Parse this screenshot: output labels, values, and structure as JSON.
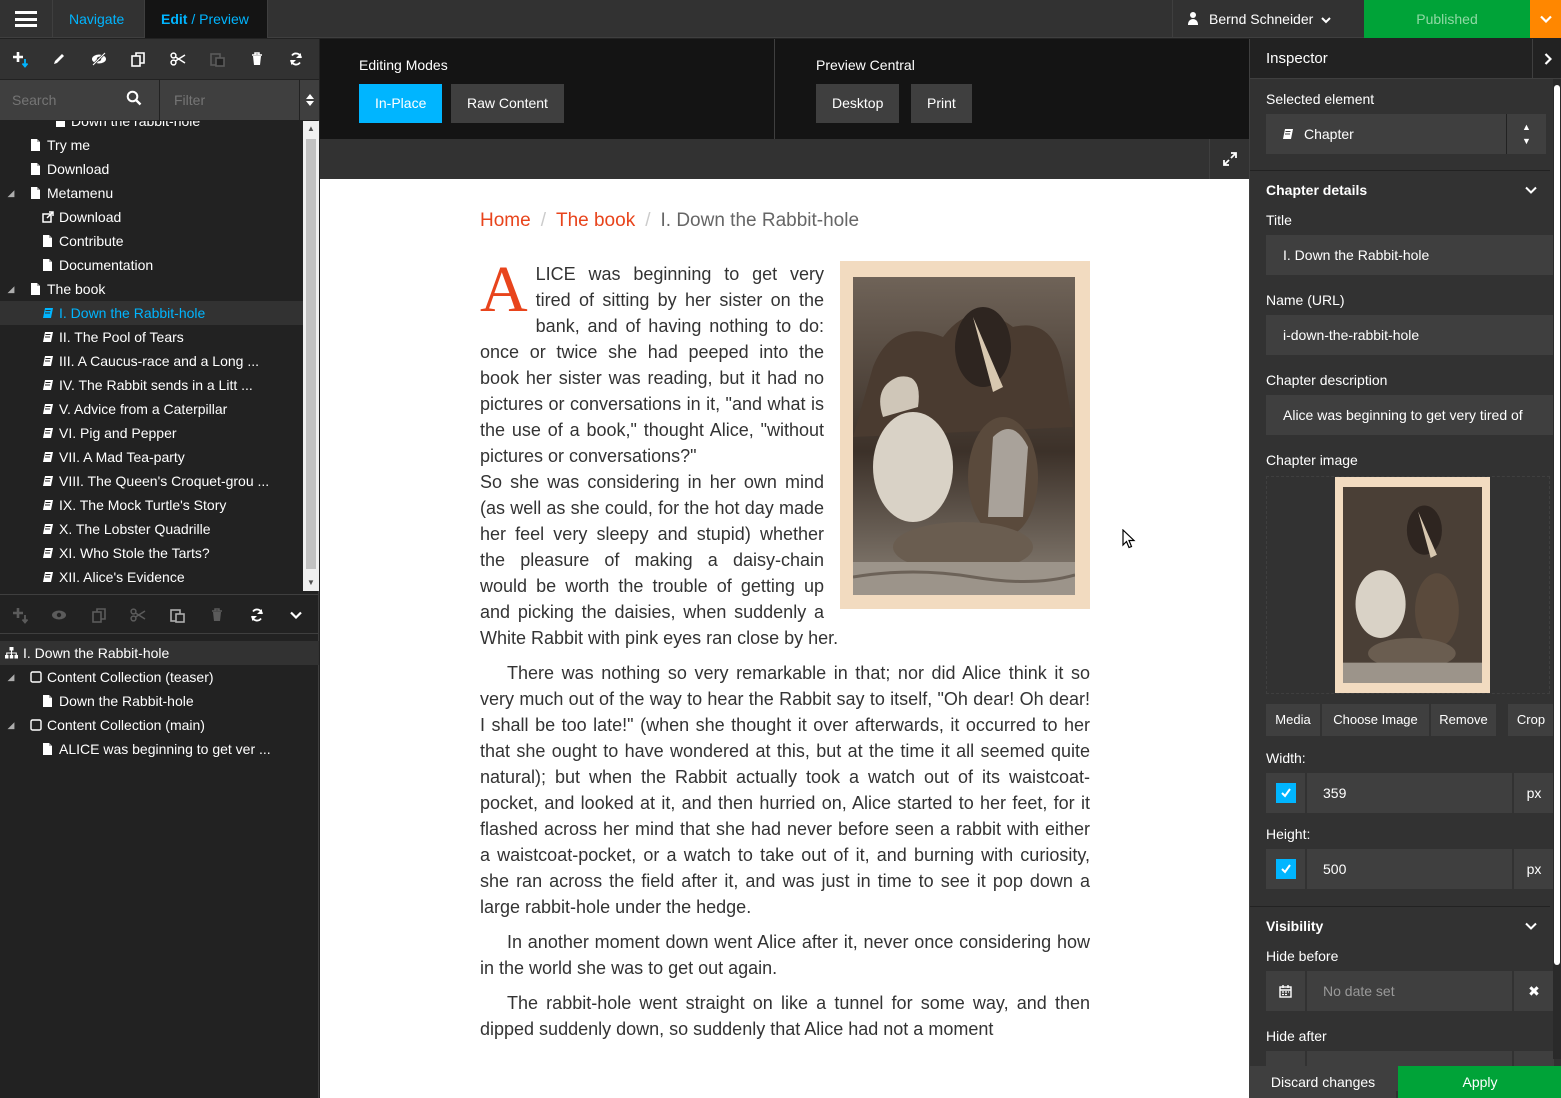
{
  "topbar": {
    "navigate_label": "Navigate",
    "edit_label": "Edit",
    "edit_sep": " / ",
    "preview_label": "Preview",
    "user_name": "Bernd Schneider",
    "published_label": "Published"
  },
  "sidebar": {
    "search_placeholder": "Search",
    "filter_placeholder": "Filter",
    "tree": [
      {
        "label": "Down the rabbit-hole",
        "icon": "document-icon"
      },
      {
        "label": "Try me",
        "icon": "document-icon"
      },
      {
        "label": "Download",
        "icon": "document-icon"
      },
      {
        "label": "Metamenu",
        "icon": "document-icon"
      },
      {
        "label": "Download",
        "icon": "external-link-icon"
      },
      {
        "label": "Contribute",
        "icon": "document-icon"
      },
      {
        "label": "Documentation",
        "icon": "document-icon"
      },
      {
        "label": "The book",
        "icon": "document-icon"
      },
      {
        "label": "I. Down the Rabbit-hole",
        "icon": "book-icon"
      },
      {
        "label": "II. The Pool of Tears",
        "icon": "book-icon"
      },
      {
        "label": "III. A Caucus-race and a Long ...",
        "icon": "book-icon"
      },
      {
        "label": "IV. The Rabbit sends in a Litt ...",
        "icon": "book-icon"
      },
      {
        "label": "V. Advice from a Caterpillar",
        "icon": "book-icon"
      },
      {
        "label": "VI. Pig and Pepper",
        "icon": "book-icon"
      },
      {
        "label": "VII. A Mad Tea-party",
        "icon": "book-icon"
      },
      {
        "label": "VIII. The Queen's Croquet-grou ...",
        "icon": "book-icon"
      },
      {
        "label": "IX. The Mock Turtle's Story",
        "icon": "book-icon"
      },
      {
        "label": "X. The Lobster Quadrille",
        "icon": "book-icon"
      },
      {
        "label": "XI. Who Stole the Tarts?",
        "icon": "book-icon"
      },
      {
        "label": "XII. Alice's Evidence",
        "icon": "book-icon"
      }
    ],
    "structure": [
      {
        "label": "I. Down the Rabbit-hole",
        "icon": "sitemap-icon"
      },
      {
        "label": "Content Collection (teaser)",
        "icon": "collection-icon"
      },
      {
        "label": "Down the Rabbit-hole",
        "icon": "document-icon"
      },
      {
        "label": "Content Collection (main)",
        "icon": "collection-icon"
      },
      {
        "label": "ALICE was beginning to get ver ...",
        "icon": "document-icon"
      }
    ]
  },
  "modes": {
    "editing_title": "Editing Modes",
    "in_place_label": "In-Place",
    "raw_content_label": "Raw Content",
    "preview_title": "Preview Central",
    "desktop_label": "Desktop",
    "print_label": "Print"
  },
  "page": {
    "breadcrumb": [
      "Home",
      "The book",
      "I. Down the Rabbit-hole"
    ],
    "dropcap": "A",
    "p1a": "LICE was beginning to get very tired of sitting by her sister on the bank, and of having nothing to do: once or twice she had peeped into the book her sister was reading, but it had no pictures or conversations in it, \"and what is the use of a book,\" thought Alice, \"without pictures or conversations?\"",
    "p1b": "So she was considering in her own mind (as well as she could, for the hot day made her feel very sleepy and stupid) whether the pleasure of making a daisy-chain would be worth the trouble of getting up and picking the daisies, when suddenly a White Rabbit with pink eyes ran close by her.",
    "p2": "There was nothing so very remarkable in that; nor did Alice think it so very much out of the way to hear the Rabbit say to itself, \"Oh dear! Oh dear! I shall be too late!\" (when she thought it over afterwards, it occurred to her that she ought to have wondered at this, but at the time it all seemed quite natural); but when the Rabbit actually took a watch out of its waistcoat-pocket, and looked at it, and then hurried on, Alice started to her feet, for it flashed across her mind that she had never before seen a rabbit with either a waistcoat-pocket, or a watch to take out of it, and burning with curiosity, she ran across the field after it, and was just in time to see it pop down a large rabbit-hole under the hedge.",
    "p3": "In another moment down went Alice after it, never once considering how in the world she was to get out again.",
    "p4": "The rabbit-hole went straight on like a tunnel for some way, and then dipped suddenly down, so suddenly that Alice had not a moment"
  },
  "inspector": {
    "title": "Inspector",
    "selected_label": "Selected element",
    "selected_value": "Chapter",
    "chapter_details": "Chapter details",
    "title_label": "Title",
    "title_value": "I. Down the Rabbit-hole",
    "name_label": "Name (URL)",
    "name_value": "i-down-the-rabbit-hole",
    "desc_label": "Chapter description",
    "desc_value": "Alice was beginning to get very tired of",
    "image_label": "Chapter image",
    "media_label": "Media",
    "choose_label": "Choose Image",
    "remove_label": "Remove",
    "crop_label": "Crop",
    "width_label": "Width:",
    "width_value": "359",
    "height_label": "Height:",
    "height_value": "500",
    "unit": "px",
    "visibility": "Visibility",
    "hide_before": "Hide before",
    "no_date": "No date set",
    "hide_after": "Hide after",
    "discard_label": "Discard changes",
    "apply_label": "Apply"
  },
  "colors": {
    "accent": "#00b5ff",
    "published": "#00a338",
    "publish_dropdown": "#ff8700",
    "link": "#e8441c"
  }
}
